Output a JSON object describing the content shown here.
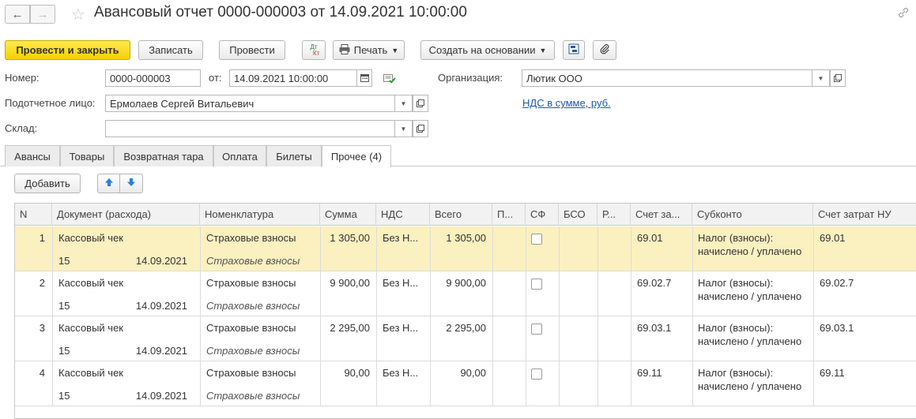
{
  "header": {
    "title": "Авансовый отчет 0000-000003 от 14.09.2021 10:00:00"
  },
  "toolbar": {
    "post_close": "Провести и закрыть",
    "save": "Записать",
    "post": "Провести",
    "dtkt_top": "Дт",
    "dtkt_bottom": "Кт",
    "print": "Печать",
    "create_based": "Создать на основании"
  },
  "form": {
    "number_label": "Номер:",
    "number_value": "0000-000003",
    "date_label": "от:",
    "date_value": "14.09.2021 10:00:00",
    "org_label": "Организация:",
    "org_value": "Лютик ООО",
    "person_label": "Подотчетное лицо:",
    "person_value": "Ермолаев Сергей Витальевич",
    "vat_link": "НДС в сумме, руб.",
    "warehouse_label": "Склад:",
    "warehouse_value": ""
  },
  "tabs": [
    {
      "label": "Авансы"
    },
    {
      "label": "Товары"
    },
    {
      "label": "Возвратная тара"
    },
    {
      "label": "Оплата"
    },
    {
      "label": "Билеты"
    },
    {
      "label": "Прочее (4)"
    }
  ],
  "table_toolbar": {
    "add": "Добавить"
  },
  "table": {
    "headers": [
      "N",
      "Документ (расхода)",
      "Номенклатура",
      "Сумма",
      "НДС",
      "Всего",
      "П...",
      "СФ",
      "БСО",
      "Р...",
      "Счет за...",
      "Субконто",
      "Счет затрат НУ"
    ],
    "rows": [
      {
        "n": "1",
        "doc": "Кассовый чек",
        "doc_num": "15",
        "doc_date": "14.09.2021",
        "item": "Страховые взносы",
        "item2": "Страховые взносы",
        "sum": "1 305,00",
        "vat": "Без Н...",
        "total": "1 305,00",
        "account": "69.01",
        "sub1": "Налог (взносы):",
        "sub2": "начислено / уплачено",
        "account_nu": "69.01"
      },
      {
        "n": "2",
        "doc": "Кассовый чек",
        "doc_num": "15",
        "doc_date": "14.09.2021",
        "item": "Страховые взносы",
        "item2": "Страховые взносы",
        "sum": "9 900,00",
        "vat": "Без Н...",
        "total": "9 900,00",
        "account": "69.02.7",
        "sub1": "Налог (взносы):",
        "sub2": "начислено / уплачено",
        "account_nu": "69.02.7"
      },
      {
        "n": "3",
        "doc": "Кассовый чек",
        "doc_num": "15",
        "doc_date": "14.09.2021",
        "item": "Страховые взносы",
        "item2": "Страховые взносы",
        "sum": "2 295,00",
        "vat": "Без Н...",
        "total": "2 295,00",
        "account": "69.03.1",
        "sub1": "Налог (взносы):",
        "sub2": "начислено / уплачено",
        "account_nu": "69.03.1"
      },
      {
        "n": "4",
        "doc": "Кассовый чек",
        "doc_num": "15",
        "doc_date": "14.09.2021",
        "item": "Страховые взносы",
        "item2": "Страховые взносы",
        "sum": "90,00",
        "vat": "Без Н...",
        "total": "90,00",
        "account": "69.11",
        "sub1": "Налог (взносы):",
        "sub2": "начислено / уплачено",
        "account_nu": "69.11"
      }
    ]
  }
}
